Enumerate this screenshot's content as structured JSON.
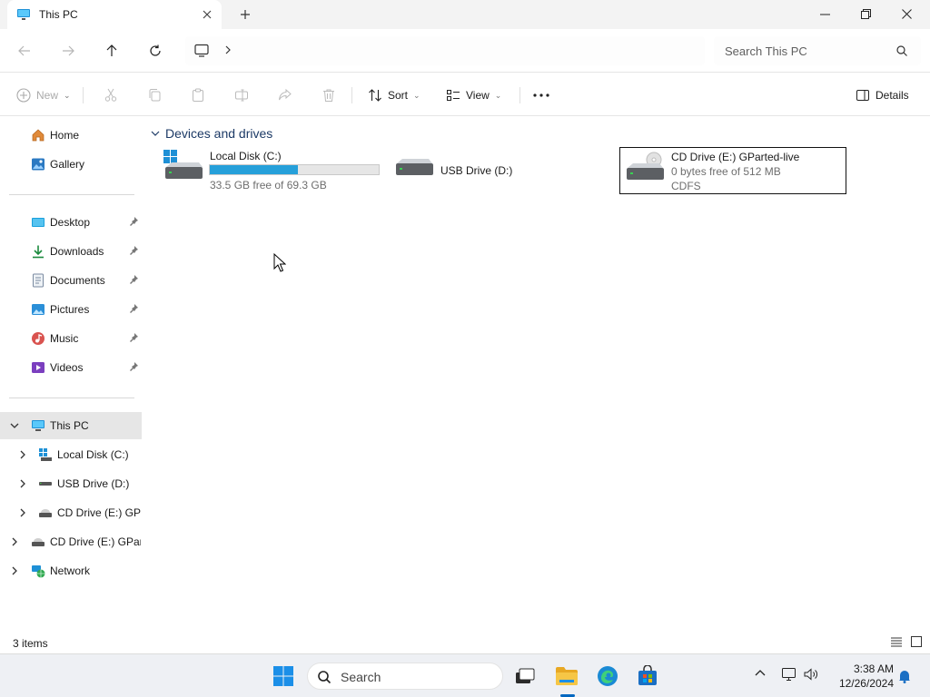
{
  "titlebar": {
    "tab_title": "This PC",
    "tab_close_icon": "close-icon",
    "new_tab_icon": "plus-icon",
    "window_controls": [
      "minimize-icon",
      "restore-icon",
      "close-icon"
    ]
  },
  "navbar": {
    "back_icon": "arrow-left-icon",
    "forward_icon": "arrow-right-icon",
    "up_icon": "arrow-up-icon",
    "refresh_icon": "refresh-icon",
    "address_icon": "monitor-icon",
    "search_placeholder": "Search This PC"
  },
  "commandbar": {
    "new_label": "New",
    "sort_label": "Sort",
    "view_label": "View",
    "details_label": "Details",
    "disabled_actions": [
      "cut-icon",
      "copy-icon",
      "paste-icon",
      "rename-icon",
      "share-icon",
      "delete-icon"
    ]
  },
  "sidebar": {
    "top": [
      {
        "label": "Home",
        "icon": "home-icon"
      },
      {
        "label": "Gallery",
        "icon": "gallery-icon"
      }
    ],
    "quick_access": [
      {
        "label": "Desktop",
        "icon": "desktop-icon"
      },
      {
        "label": "Downloads",
        "icon": "download-icon"
      },
      {
        "label": "Documents",
        "icon": "documents-icon"
      },
      {
        "label": "Pictures",
        "icon": "pictures-icon"
      },
      {
        "label": "Music",
        "icon": "music-icon"
      },
      {
        "label": "Videos",
        "icon": "videos-icon"
      }
    ],
    "tree": [
      {
        "label": "This PC",
        "icon": "this-pc-icon",
        "selected": true
      },
      {
        "label": "Local Disk (C:)",
        "icon": "local-disk-icon"
      },
      {
        "label": "USB Drive (D:)",
        "icon": "usb-drive-icon"
      },
      {
        "label": "CD Drive (E:) GParted-live",
        "icon": "cd-drive-icon"
      },
      {
        "label": "CD Drive (E:) GParted-live",
        "icon": "cd-drive-icon"
      },
      {
        "label": "Network",
        "icon": "network-icon"
      }
    ]
  },
  "content": {
    "group_title": "Devices and drives",
    "drives": [
      {
        "name": "Local Disk (C:)",
        "free_text": "33.5 GB free of 69.3 GB",
        "used_fraction": 0.52,
        "icon": "windows-drive-icon"
      },
      {
        "name": "USB Drive (D:)",
        "icon": "usb-drive-icon"
      },
      {
        "name": "CD Drive (E:) GParted-live",
        "free_text": "0 bytes free of 512 MB",
        "filesystem": "CDFS",
        "icon": "cd-drive-icon"
      }
    ]
  },
  "statusbar": {
    "item_count": "3 items"
  },
  "taskbar": {
    "search_label": "Search",
    "time": "3:38 AM",
    "date": "12/26/2024"
  },
  "colors": {
    "accent": "#0067c0",
    "progress": "#26a0da",
    "selected_bg": "#e6e6e6"
  }
}
